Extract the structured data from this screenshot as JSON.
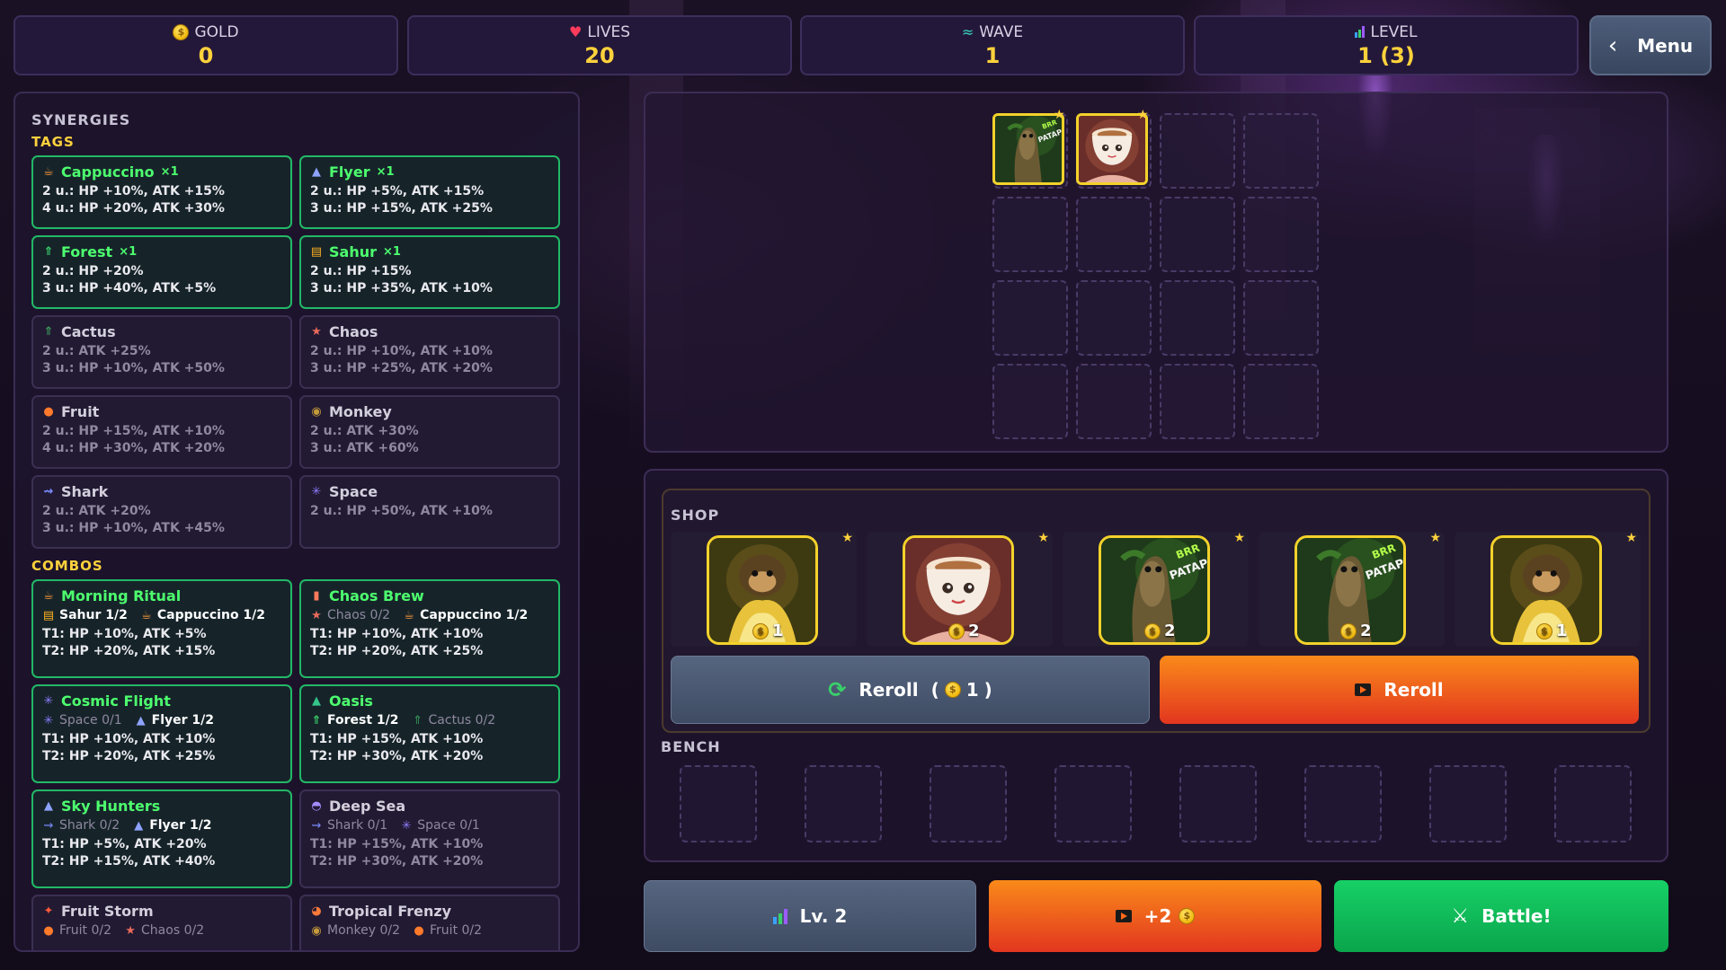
{
  "stats": [
    {
      "label": "GOLD",
      "value": "0",
      "icon": "coin-icon"
    },
    {
      "label": "LIVES",
      "value": "20",
      "icon": "heart-icon"
    },
    {
      "label": "WAVE",
      "value": "1",
      "icon": "wave-icon"
    },
    {
      "label": "LEVEL",
      "value": "1 (3)",
      "icon": "bar-chart-icon"
    }
  ],
  "menu": {
    "label": "Menu"
  },
  "synergies": {
    "title": "SYNERGIES",
    "tags_title": "TAGS",
    "tags": [
      {
        "name": "Cappuccino",
        "count": "×1",
        "active": true,
        "icon": "cup-icon",
        "lines": [
          "2 u.: HP +10%, ATK +15%",
          "4 u.: HP +20%, ATK +30%"
        ]
      },
      {
        "name": "Flyer",
        "count": "×1",
        "active": true,
        "icon": "plane-icon",
        "lines": [
          "2 u.: HP +5%, ATK +15%",
          "3 u.: HP +15%, ATK +25%"
        ]
      },
      {
        "name": "Forest",
        "count": "×1",
        "active": true,
        "icon": "tree-icon",
        "lines": [
          "2 u.: HP +20%",
          "3 u.: HP +40%, ATK +5%"
        ]
      },
      {
        "name": "Sahur",
        "count": "×1",
        "active": true,
        "icon": "drum-icon",
        "lines": [
          "2 u.: HP +15%",
          "3 u.: HP +35%, ATK +10%"
        ]
      },
      {
        "name": "Cactus",
        "count": "",
        "active": false,
        "icon": "cactus-icon",
        "lines": [
          "2 u.: ATK +25%",
          "3 u.: HP +10%, ATK +50%"
        ]
      },
      {
        "name": "Chaos",
        "count": "",
        "active": false,
        "icon": "chaos-star-icon",
        "lines": [
          "2 u.: HP +10%, ATK +10%",
          "3 u.: HP +25%, ATK +20%"
        ]
      },
      {
        "name": "Fruit",
        "count": "",
        "active": false,
        "icon": "fruit-icon",
        "lines": [
          "2 u.: HP +15%, ATK +10%",
          "4 u.: HP +30%, ATK +20%"
        ]
      },
      {
        "name": "Monkey",
        "count": "",
        "active": false,
        "icon": "monkey-icon",
        "lines": [
          "2 u.: ATK +30%",
          "3 u.: ATK +60%"
        ]
      },
      {
        "name": "Shark",
        "count": "",
        "active": false,
        "icon": "shark-icon",
        "lines": [
          "2 u.: ATK +20%",
          "3 u.: HP +10%, ATK +45%"
        ]
      },
      {
        "name": "Space",
        "count": "",
        "active": false,
        "icon": "sparkle-icon",
        "lines": [
          "2 u.: HP +50%, ATK +10%"
        ]
      }
    ],
    "combos_title": "COMBOS",
    "combos": [
      {
        "name": "Morning Ritual",
        "active": true,
        "icon": "cup-icon",
        "reqs": [
          {
            "icon": "drum-icon",
            "text": "Sahur 1/2",
            "met": true
          },
          {
            "icon": "cup-icon",
            "text": "Cappuccino 1/2",
            "met": true
          }
        ],
        "lines": [
          "T1: HP +10%, ATK +5%",
          "T2: HP +20%, ATK +15%"
        ]
      },
      {
        "name": "Chaos Brew",
        "active": true,
        "icon": "bottle-icon",
        "reqs": [
          {
            "icon": "chaos-star-icon",
            "text": "Chaos 0/2",
            "met": false
          },
          {
            "icon": "cup-icon",
            "text": "Cappuccino 1/2",
            "met": true
          }
        ],
        "lines": [
          "T1: HP +10%, ATK +10%",
          "T2: HP +20%, ATK +25%"
        ]
      },
      {
        "name": "Cosmic Flight",
        "active": true,
        "icon": "sparkle-icon",
        "reqs": [
          {
            "icon": "sparkle-icon",
            "text": "Space 0/1",
            "met": false
          },
          {
            "icon": "plane-icon",
            "text": "Flyer 1/2",
            "met": true
          }
        ],
        "lines": [
          "T1: HP +10%, ATK +10%",
          "T2: HP +20%, ATK +25%"
        ]
      },
      {
        "name": "Oasis",
        "active": true,
        "icon": "oasis-icon",
        "reqs": [
          {
            "icon": "tree-icon",
            "text": "Forest 1/2",
            "met": true
          },
          {
            "icon": "cactus-icon",
            "text": "Cactus 0/2",
            "met": false
          }
        ],
        "lines": [
          "T1: HP +15%, ATK +10%",
          "T2: HP +30%, ATK +20%"
        ]
      },
      {
        "name": "Sky Hunters",
        "active": true,
        "icon": "plane-icon",
        "reqs": [
          {
            "icon": "shark-icon",
            "text": "Shark 0/2",
            "met": false
          },
          {
            "icon": "plane-icon",
            "text": "Flyer 1/2",
            "met": true
          }
        ],
        "lines": [
          "T1: HP +5%, ATK +20%",
          "T2: HP +15%, ATK +40%"
        ]
      },
      {
        "name": "Deep Sea",
        "active": false,
        "icon": "diver-icon",
        "reqs": [
          {
            "icon": "shark-icon",
            "text": "Shark 0/1",
            "met": false
          },
          {
            "icon": "sparkle-icon",
            "text": "Space 0/1",
            "met": false
          }
        ],
        "lines": [
          "T1: HP +15%, ATK +10%",
          "T2: HP +30%, ATK +20%"
        ]
      },
      {
        "name": "Fruit Storm",
        "active": false,
        "icon": "fruit-storm-icon",
        "reqs": [
          {
            "icon": "fruit-icon",
            "text": "Fruit 0/2",
            "met": false
          },
          {
            "icon": "chaos-star-icon",
            "text": "Chaos 0/2",
            "met": false
          }
        ],
        "lines": []
      },
      {
        "name": "Tropical Frenzy",
        "active": false,
        "icon": "tropical-icon",
        "reqs": [
          {
            "icon": "monkey-icon",
            "text": "Monkey 0/2",
            "met": false
          },
          {
            "icon": "fruit-icon",
            "text": "Fruit 0/2",
            "met": false
          }
        ],
        "lines": []
      }
    ]
  },
  "board": {
    "units": [
      {
        "name": "brr-brr-patapim-unit",
        "row": 0,
        "col": 0,
        "art": "treeman"
      },
      {
        "name": "cappuccino-unit",
        "row": 0,
        "col": 1,
        "art": "cup"
      }
    ],
    "art_labels": {
      "treeman": "BRR BRR PATAPIM"
    }
  },
  "shop": {
    "title": "SHOP",
    "slots": [
      {
        "art": "monkey",
        "cost": "1"
      },
      {
        "art": "cup",
        "cost": "2"
      },
      {
        "art": "treeman",
        "cost": "2"
      },
      {
        "art": "treeman",
        "cost": "2"
      },
      {
        "art": "monkey",
        "cost": "1"
      }
    ],
    "reroll_label": "Reroll",
    "reroll_cost_open": "(",
    "reroll_cost": "1",
    "reroll_cost_close": ")",
    "ad_reroll_label": "Reroll",
    "bench_title": "BENCH"
  },
  "actions": {
    "level_label": "Lv. 2",
    "ad_gold_label": "+2",
    "battle_label": "Battle!"
  },
  "colors": {
    "gold": "#ffd23c",
    "active_green": "#4dff6e",
    "battle": "#12c45a",
    "ad": "#f0681a"
  }
}
